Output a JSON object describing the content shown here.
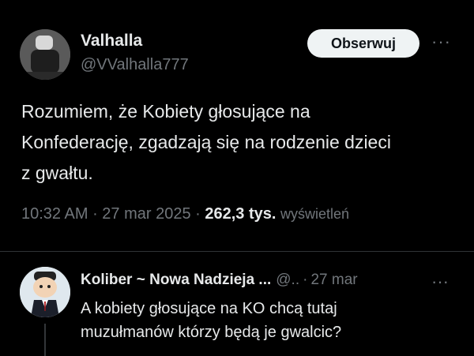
{
  "tweet": {
    "author_name": "Valhalla",
    "author_handle": "@VValhalla777",
    "follow_label": "Obserwuj",
    "more_label": "···",
    "text": "Rozumiem, że Kobiety głosujące na\nKonfederację, zgadzają się na rodzenie dzieci\nz gwałtu.",
    "time": "10:32 AM",
    "date": "27 mar 2025",
    "views_count": "262,3 tys.",
    "views_label": "wyświetleń"
  },
  "reply": {
    "author_name": "Koliber ~ Nowa Nadzieja ...",
    "author_handle": "@..",
    "time": "27 mar",
    "more_label": "···",
    "text": "A kobiety głosujące na KO chcą tutaj\nmuzułmanów którzy będą je gwalcic?"
  },
  "icons": {
    "more": "more-horizontal-icon"
  }
}
